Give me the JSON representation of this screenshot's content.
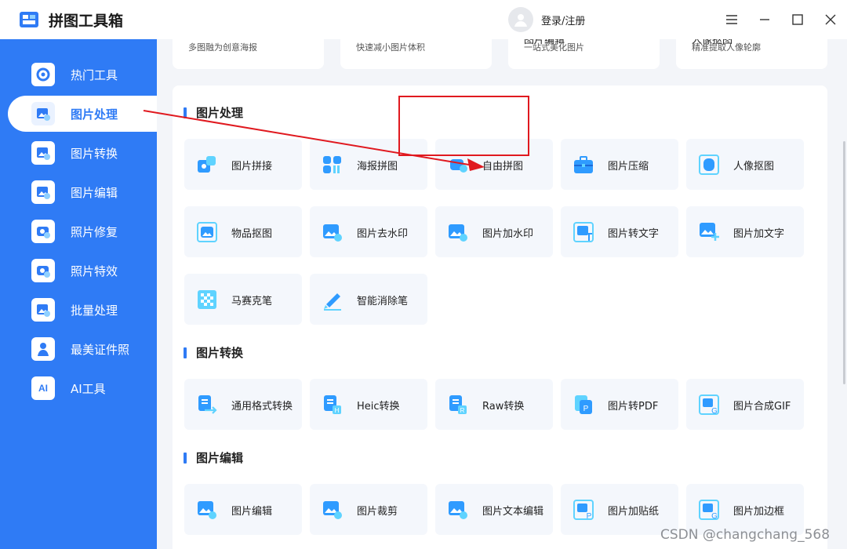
{
  "app": {
    "title": "拼图工具箱",
    "login_label": "登录/注册"
  },
  "sidebar": {
    "items": [
      {
        "label": "热门工具",
        "icon": "hot-tools-icon"
      },
      {
        "label": "图片处理",
        "icon": "image-process-icon",
        "active": true
      },
      {
        "label": "图片转换",
        "icon": "image-convert-icon"
      },
      {
        "label": "图片编辑",
        "icon": "image-edit-icon"
      },
      {
        "label": "照片修复",
        "icon": "photo-repair-icon"
      },
      {
        "label": "照片特效",
        "icon": "photo-effect-icon"
      },
      {
        "label": "批量处理",
        "icon": "batch-icon"
      },
      {
        "label": "最美证件照",
        "icon": "id-photo-icon"
      },
      {
        "label": "AI工具",
        "icon": "ai-icon"
      }
    ]
  },
  "top_cards": [
    {
      "title": "",
      "subtitle": "多图融为创意海报"
    },
    {
      "title": "",
      "subtitle": "快速减小图片体积"
    },
    {
      "title": "图片编辑",
      "subtitle": "一站式美化图片"
    },
    {
      "title": "人像抠图",
      "subtitle": "精准提取人像轮廓"
    }
  ],
  "sections": [
    {
      "title": "图片处理",
      "tiles": [
        "图片拼接",
        "海报拼图",
        "自由拼图",
        "图片压缩",
        "人像抠图",
        "物品抠图",
        "图片去水印",
        "图片加水印",
        "图片转文字",
        "图片加文字",
        "马赛克笔",
        "智能消除笔"
      ]
    },
    {
      "title": "图片转换",
      "tiles": [
        "通用格式转换",
        "Heic转换",
        "Raw转换",
        "图片转PDF",
        "图片合成GIF"
      ]
    },
    {
      "title": "图片编辑",
      "tiles": [
        "图片编辑",
        "图片裁剪",
        "图片文本编辑",
        "图片加贴纸",
        "图片加边框"
      ]
    }
  ],
  "watermark": "CSDN @changchang_568",
  "colors": {
    "accent": "#2f7bf5",
    "highlight": "#e0191f"
  }
}
